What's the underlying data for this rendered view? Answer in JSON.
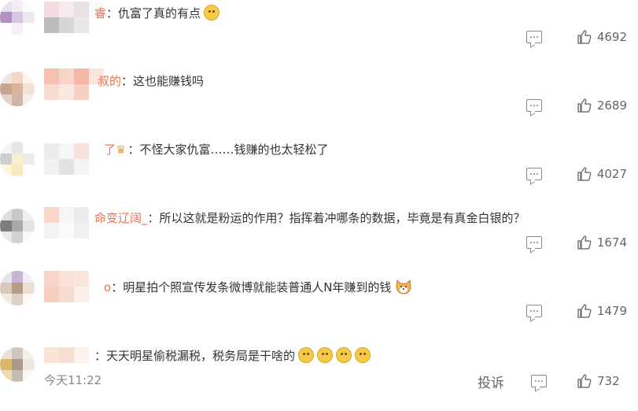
{
  "comments": [
    {
      "name": "睿",
      "text": "仇富了真的有点",
      "likes": "4692"
    },
    {
      "name": "叔的",
      "text": "这也能赚钱吗",
      "likes": "2689"
    },
    {
      "name": "了",
      "text": "不怪大家仇富……钱赚的也太轻松了",
      "likes": "4027"
    },
    {
      "name": "命变辽阔_",
      "text": "所以这就是粉运的作用？指挥着冲哪条的数据，毕竟是有真金白银的？",
      "likes": "1674"
    },
    {
      "name": "o",
      "text": "明星拍个照宣传发条微博就能装普通人N年赚到的钱",
      "likes": "1479"
    },
    {
      "name": "",
      "text": "天天明星偷税漏税，税务局是干啥的",
      "likes": "732",
      "time": "今天11:22",
      "report": "投诉"
    }
  ],
  "colon": "：",
  "icons": {
    "reply": "comment-icon",
    "like": "thumbs-up-icon"
  },
  "colors": {
    "username": "#eb7350",
    "text": "#333333",
    "meta": "#888888"
  }
}
